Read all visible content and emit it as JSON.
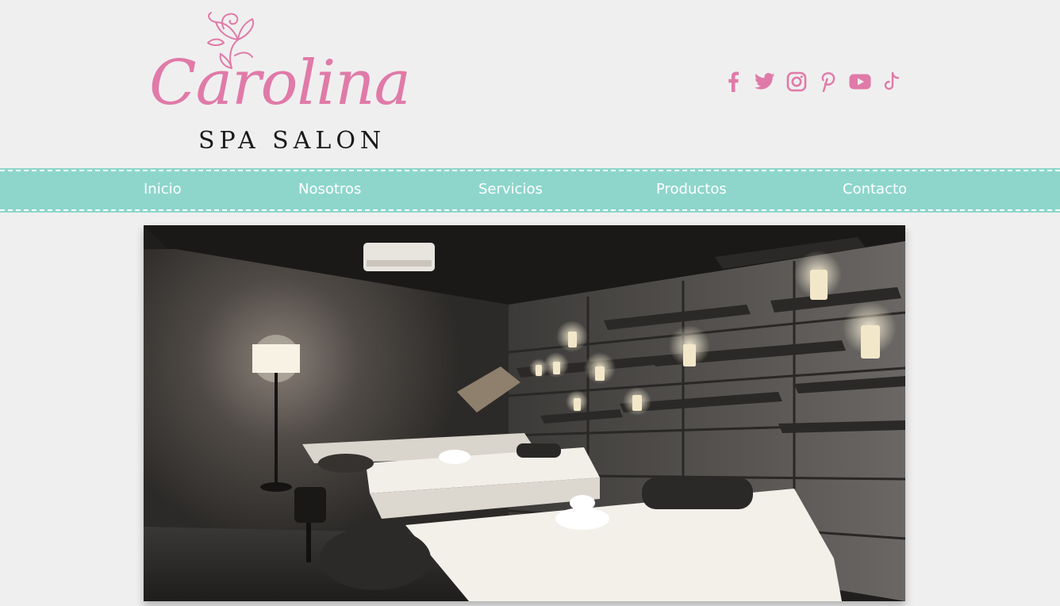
{
  "brand": {
    "script_name": "Carolina",
    "subtitle": "SPA SALON",
    "accent_color": "#e07aa8"
  },
  "social": {
    "icons": [
      "facebook-icon",
      "twitter-icon",
      "instagram-icon",
      "pinterest-icon",
      "youtube-icon",
      "tiktok-icon"
    ]
  },
  "nav": {
    "background": "#8ed6cc",
    "items": [
      {
        "label": "Inicio"
      },
      {
        "label": "Nosotros"
      },
      {
        "label": "Servicios"
      },
      {
        "label": "Productos"
      },
      {
        "label": "Contacto"
      }
    ]
  },
  "hero": {
    "subject": "spa-treatment-room-photo"
  }
}
